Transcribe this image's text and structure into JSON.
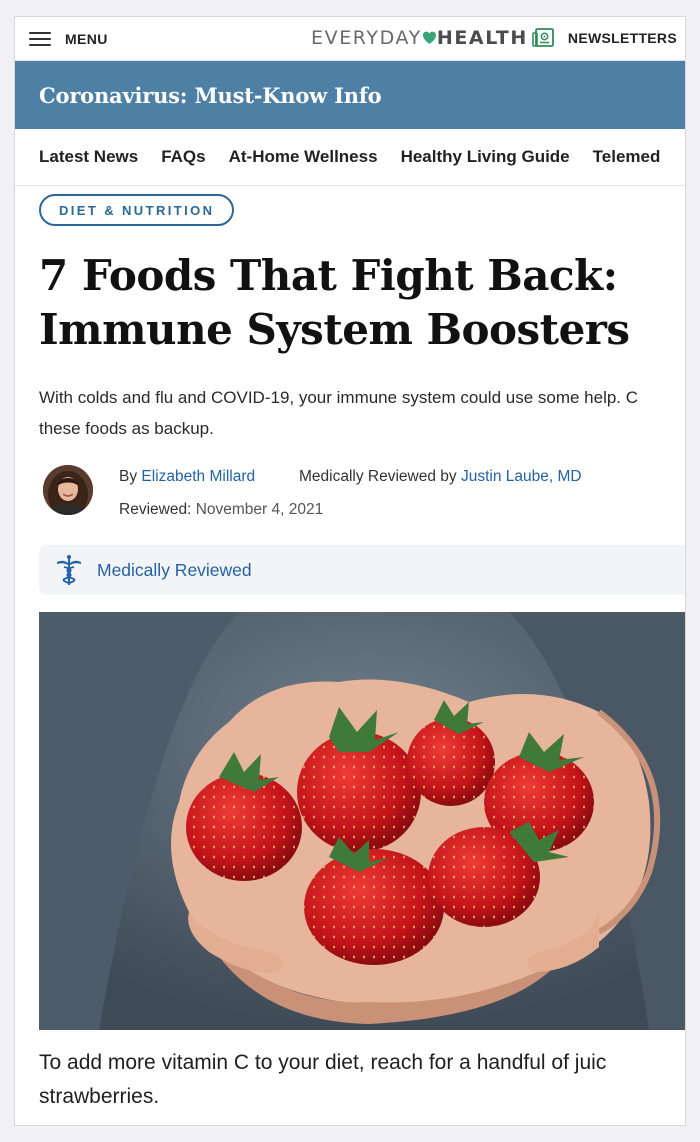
{
  "header": {
    "menu_label": "MENU",
    "logo": {
      "part1": "EVERYDAY",
      "part2": "HEALTH"
    },
    "newsletters_label": "NEWSLETTERS"
  },
  "banner": {
    "text": "Coronavirus: Must-Know Info"
  },
  "nav": {
    "items": [
      {
        "label": "Latest News"
      },
      {
        "label": "FAQs"
      },
      {
        "label": "At-Home Wellness"
      },
      {
        "label": "Healthy Living Guide"
      },
      {
        "label": "Telemed"
      }
    ]
  },
  "article": {
    "category": "DIET & NUTRITION",
    "title_line1": "7 Foods That Fight Back:",
    "title_line2": "Immune System Boosters",
    "dek_line1": "With colds and flu and COVID-19, your immune system could use some help. C",
    "dek_line2": "these foods as backup.",
    "byline": {
      "by": "By",
      "author": "Elizabeth Millard",
      "reviewed_by": "Medically Reviewed by",
      "reviewer": "Justin Laube, MD",
      "reviewed_label": "Reviewed:",
      "reviewed_date": "November 4, 2021"
    },
    "medical_badge": "Medically Reviewed",
    "caption_line1": "To add more vitamin C to your diet, reach for a handful of juic",
    "caption_line2": "strawberries."
  },
  "colors": {
    "banner": "#4e7fa5",
    "link": "#2462a4",
    "tag": "#2b6797",
    "logo_heart": "#3aa57a"
  }
}
